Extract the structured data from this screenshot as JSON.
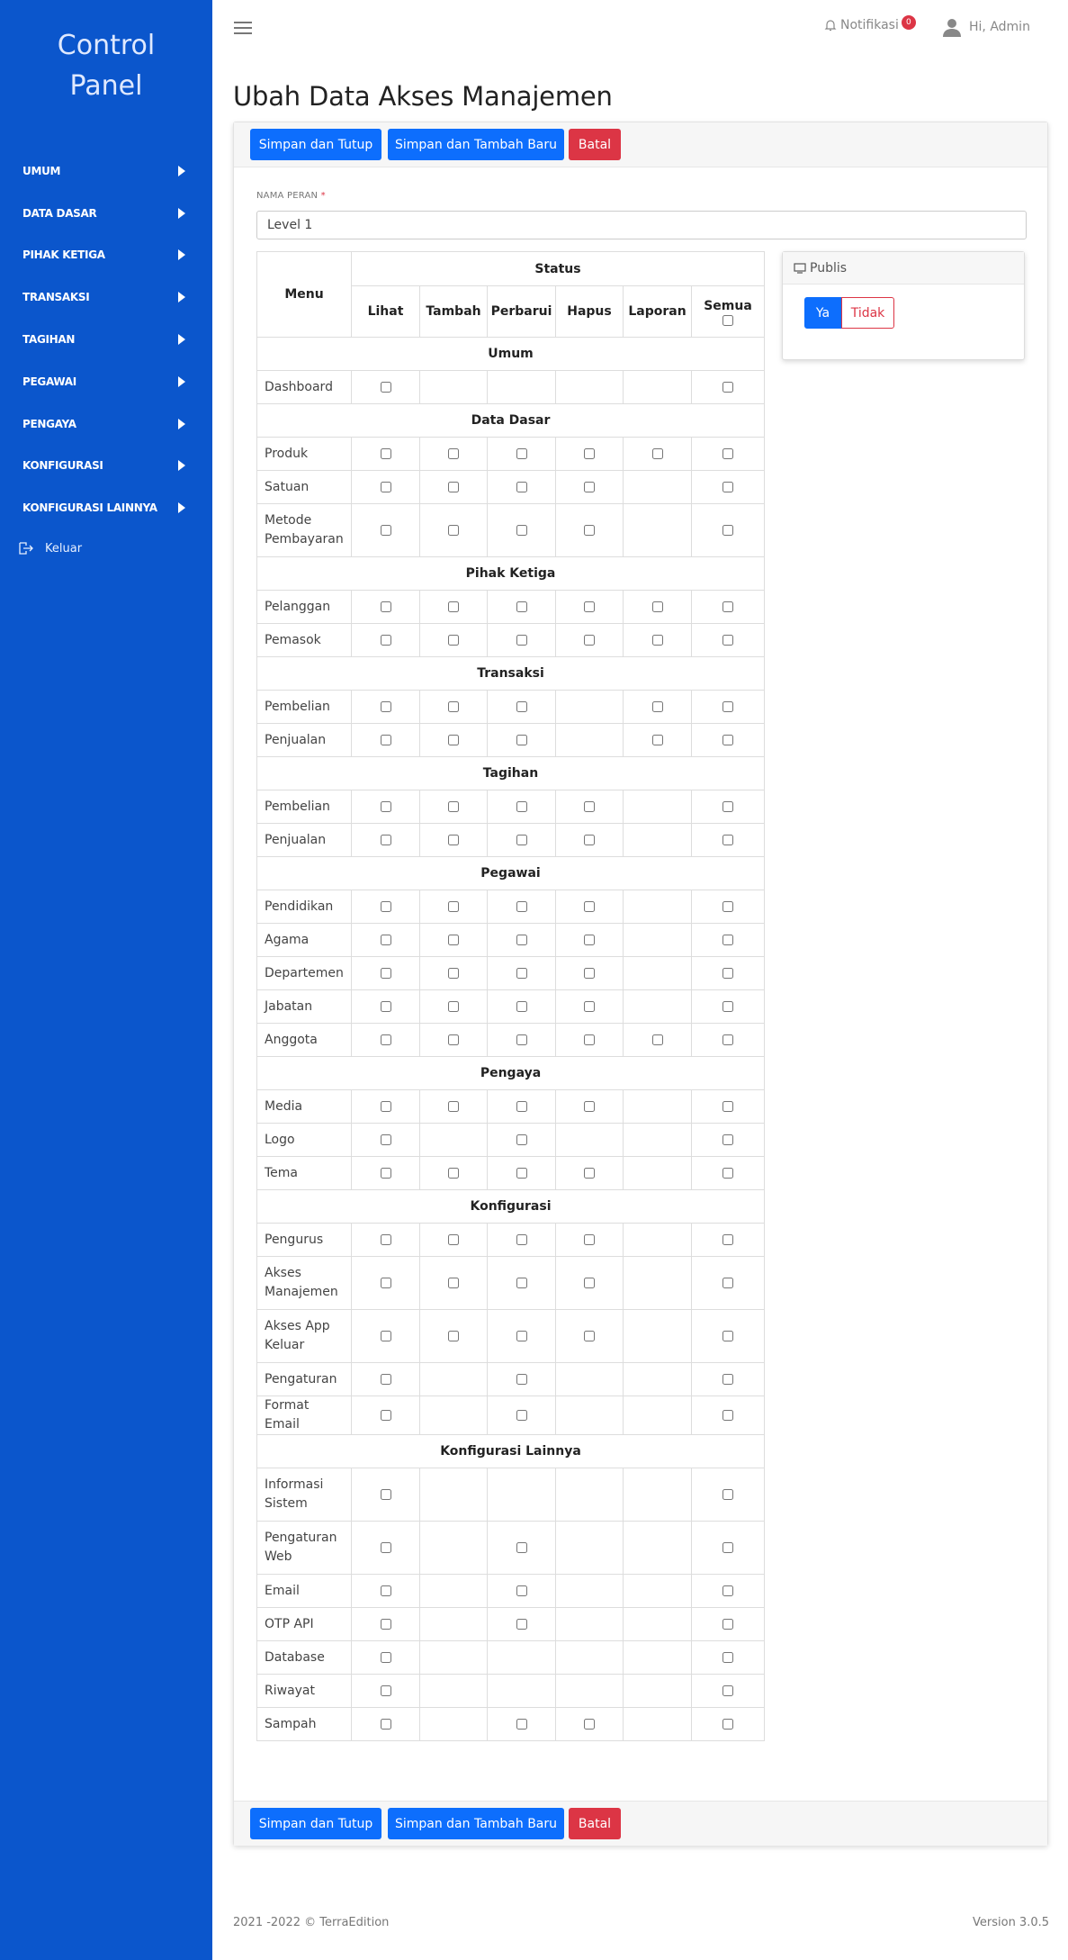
{
  "brand": {
    "line1": "Control",
    "line2": "Panel"
  },
  "sidebar": {
    "items": [
      {
        "label": "UMUM"
      },
      {
        "label": "DATA DASAR"
      },
      {
        "label": "PIHAK KETIGA"
      },
      {
        "label": "TRANSAKSI"
      },
      {
        "label": "TAGIHAN"
      },
      {
        "label": "PEGAWAI"
      },
      {
        "label": "PENGAYA"
      },
      {
        "label": "KONFIGURASI"
      },
      {
        "label": "KONFIGURASI LAINNYA"
      }
    ],
    "logout_label": "Keluar"
  },
  "topbar": {
    "notif_label": "Notifikasi",
    "notif_count": "0",
    "user_label": "Hi, Admin"
  },
  "page_title": "Ubah Data Akses Manajemen",
  "buttons": {
    "save_close": "Simpan dan Tutup",
    "save_new": "Simpan dan Tambah Baru",
    "cancel": "Batal"
  },
  "form": {
    "role_label": "NAMA PERAN",
    "role_required": "*",
    "role_value": "Level 1"
  },
  "table": {
    "menu_header": "Menu",
    "status_header": "Status",
    "columns": [
      "Lihat",
      "Tambah",
      "Perbarui",
      "Hapus",
      "Laporan",
      "Semua"
    ],
    "sections": [
      {
        "title": "Umum",
        "rows": [
          {
            "name": "Dashboard",
            "cells": [
              1,
              0,
              0,
              0,
              0,
              1
            ],
            "checked": [
              1
            ]
          }
        ]
      },
      {
        "title": "Data Dasar",
        "rows": [
          {
            "name": "Produk",
            "cells": [
              1,
              1,
              1,
              1,
              1,
              1
            ]
          },
          {
            "name": "Satuan",
            "cells": [
              1,
              1,
              1,
              1,
              0,
              1
            ]
          },
          {
            "name": "Metode Pembayaran",
            "cells": [
              1,
              1,
              1,
              1,
              0,
              1
            ]
          }
        ]
      },
      {
        "title": "Pihak Ketiga",
        "rows": [
          {
            "name": "Pelanggan",
            "cells": [
              1,
              1,
              1,
              1,
              1,
              1
            ]
          },
          {
            "name": "Pemasok",
            "cells": [
              1,
              1,
              1,
              1,
              1,
              1
            ]
          }
        ]
      },
      {
        "title": "Transaksi",
        "rows": [
          {
            "name": "Pembelian",
            "cells": [
              1,
              1,
              1,
              0,
              1,
              1
            ]
          },
          {
            "name": "Penjualan",
            "cells": [
              1,
              1,
              1,
              0,
              1,
              1
            ]
          }
        ]
      },
      {
        "title": "Tagihan",
        "rows": [
          {
            "name": "Pembelian",
            "cells": [
              1,
              1,
              1,
              1,
              0,
              1
            ]
          },
          {
            "name": "Penjualan",
            "cells": [
              1,
              1,
              1,
              1,
              0,
              1
            ]
          }
        ]
      },
      {
        "title": "Pegawai",
        "rows": [
          {
            "name": "Pendidikan",
            "cells": [
              1,
              1,
              1,
              1,
              0,
              1
            ]
          },
          {
            "name": "Agama",
            "cells": [
              1,
              1,
              1,
              1,
              0,
              1
            ]
          },
          {
            "name": "Departemen",
            "cells": [
              1,
              1,
              1,
              1,
              0,
              1
            ]
          },
          {
            "name": "Jabatan",
            "cells": [
              1,
              1,
              1,
              1,
              0,
              1
            ]
          },
          {
            "name": "Anggota",
            "cells": [
              1,
              1,
              1,
              1,
              1,
              1
            ]
          }
        ]
      },
      {
        "title": "Pengaya",
        "rows": [
          {
            "name": "Media",
            "cells": [
              1,
              1,
              1,
              1,
              0,
              1
            ]
          },
          {
            "name": "Logo",
            "cells": [
              1,
              0,
              1,
              0,
              0,
              1
            ]
          },
          {
            "name": "Tema",
            "cells": [
              1,
              1,
              1,
              1,
              0,
              1
            ]
          }
        ]
      },
      {
        "title": "Konfigurasi",
        "rows": [
          {
            "name": "Pengurus",
            "cells": [
              1,
              1,
              1,
              1,
              0,
              1
            ]
          },
          {
            "name": "Akses Manajemen",
            "cells": [
              1,
              1,
              1,
              1,
              0,
              1
            ]
          },
          {
            "name": "Akses App Keluar",
            "cells": [
              1,
              1,
              1,
              1,
              0,
              1
            ]
          },
          {
            "name": "Pengaturan",
            "cells": [
              1,
              0,
              1,
              0,
              0,
              1
            ]
          },
          {
            "name": "Format Email",
            "cells": [
              1,
              0,
              1,
              0,
              0,
              1
            ]
          }
        ]
      },
      {
        "title": "Konfigurasi Lainnya",
        "rows": [
          {
            "name": "Informasi Sistem",
            "cells": [
              1,
              0,
              0,
              0,
              0,
              1
            ]
          },
          {
            "name": "Pengaturan Web",
            "cells": [
              1,
              0,
              1,
              0,
              0,
              1
            ]
          },
          {
            "name": "Email",
            "cells": [
              1,
              0,
              1,
              0,
              0,
              1
            ]
          },
          {
            "name": "OTP API",
            "cells": [
              1,
              0,
              1,
              0,
              0,
              1
            ]
          },
          {
            "name": "Database",
            "cells": [
              1,
              0,
              0,
              0,
              0,
              1
            ]
          },
          {
            "name": "Riwayat",
            "cells": [
              1,
              0,
              0,
              0,
              0,
              1
            ]
          },
          {
            "name": "Sampah",
            "cells": [
              1,
              0,
              1,
              1,
              0,
              1
            ]
          }
        ]
      }
    ]
  },
  "publis": {
    "title": "Publis",
    "yes": "Ya",
    "no": "Tidak",
    "selected": "Ya"
  },
  "footer": {
    "copyright": "2021 -2022 © TerraEdition",
    "version": "Version 3.0.5"
  },
  "colors": {
    "sidebar": "#0b56cc",
    "primary": "#0d6efd",
    "danger": "#dc3545"
  }
}
